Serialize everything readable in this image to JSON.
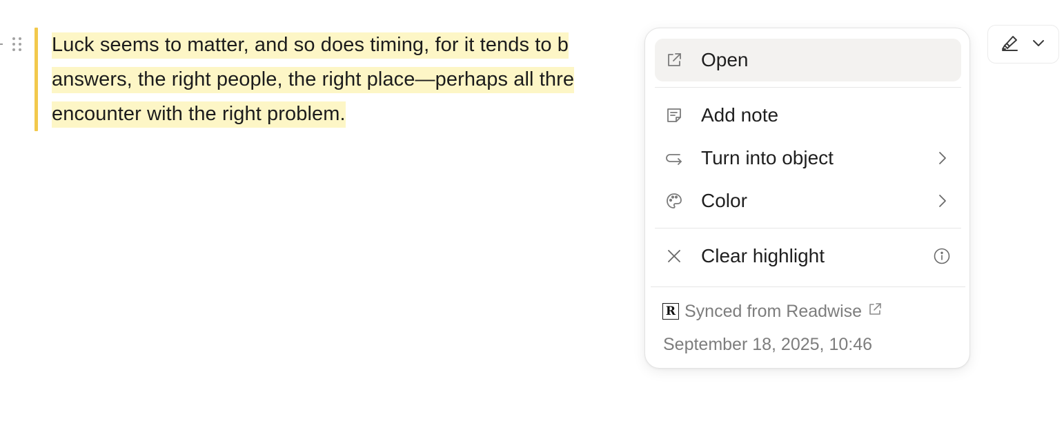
{
  "highlight": {
    "lines": [
      "Luck seems to matter, and so does timing, for it tends to b",
      "answers, the right people, the right place—perhaps all thre",
      "encounter with the right problem."
    ],
    "bar_color": "#f2c94c",
    "bg_color": "#fdf6c6"
  },
  "toolbar": {
    "highlighter_icon": "highlighter-icon",
    "dropdown_icon": "chevron-down-icon"
  },
  "menu": {
    "items": [
      {
        "label": "Open",
        "icon": "external-link-icon",
        "active": true
      },
      {
        "label": "Add note",
        "icon": "note-icon"
      },
      {
        "label": "Turn into object",
        "icon": "turn-into-arrow-icon",
        "submenu": true
      },
      {
        "label": "Color",
        "icon": "palette-icon",
        "submenu": true
      },
      {
        "label": "Clear highlight",
        "icon": "close-icon",
        "info": true
      }
    ],
    "footer": {
      "source_logo": "readwise-logo",
      "logo_letter": "R",
      "synced_text": "Synced from Readwise",
      "date": "September 18, 2025, 10:46"
    }
  }
}
